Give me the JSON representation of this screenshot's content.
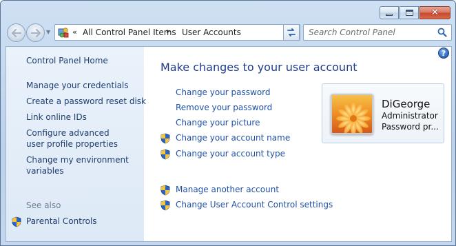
{
  "window": {
    "caption_buttons": [
      "minimize",
      "maximize",
      "close"
    ]
  },
  "nav": {
    "back_icon": "back-arrow-icon",
    "forward_icon": "forward-arrow-icon"
  },
  "address_bar": {
    "overflow": "«",
    "crumbs": [
      "All Control Panel Items",
      "User Accounts"
    ],
    "separator": "▸"
  },
  "search": {
    "placeholder": "Search Control Panel"
  },
  "sidebar": {
    "home": "Control Panel Home",
    "links": [
      "Manage your credentials",
      "Create a password reset disk",
      "Link online IDs",
      "Configure advanced user profile properties",
      "Change my environment variables"
    ],
    "see_also_label": "See also",
    "see_also_links": [
      "Parental Controls"
    ]
  },
  "main": {
    "title": "Make changes to your user account",
    "tasks": [
      "Change your password",
      "Remove your password",
      "Change your picture",
      "Change your account name",
      "Change your account type"
    ],
    "other_tasks": [
      "Manage another account",
      "Change User Account Control settings"
    ]
  },
  "account": {
    "name": "DiGeorge",
    "role": "Administrator",
    "password_status": "Password pr..."
  },
  "colors": {
    "link": "#1f50a5",
    "title": "#1e3b8a",
    "sidebar_bg": "#e4eef9",
    "frame": "#bcd2ea"
  }
}
